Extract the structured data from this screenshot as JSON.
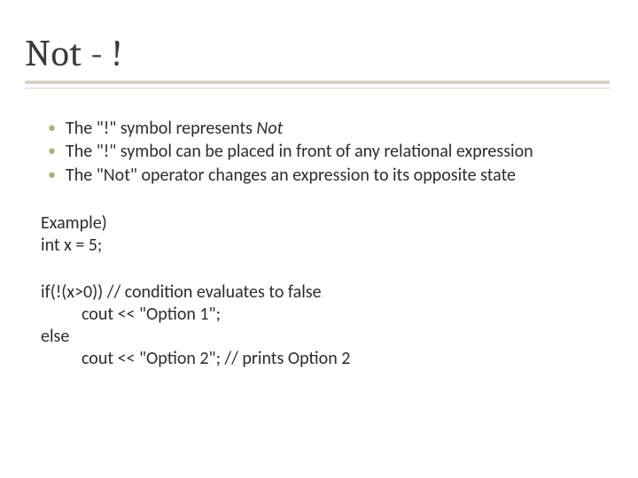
{
  "title": "Not - !",
  "bullets": [
    {
      "pre": "The \"!\" symbol represents ",
      "em": "Not",
      "post": ""
    },
    {
      "pre": "The \"!\" symbol can be placed in front of any relational expression",
      "em": "",
      "post": ""
    },
    {
      "pre": "The \"Not\" operator changes an expression to its opposite state",
      "em": "",
      "post": ""
    }
  ],
  "example": {
    "label": "Example)",
    "decl": "int x = 5;"
  },
  "code": {
    "if_line": "if(!(x>0))  // condition evaluates to false",
    "if_body": "cout << \"Option 1\";",
    "else_line": "else",
    "else_body": "cout << \"Option 2\";   // prints Option 2"
  }
}
